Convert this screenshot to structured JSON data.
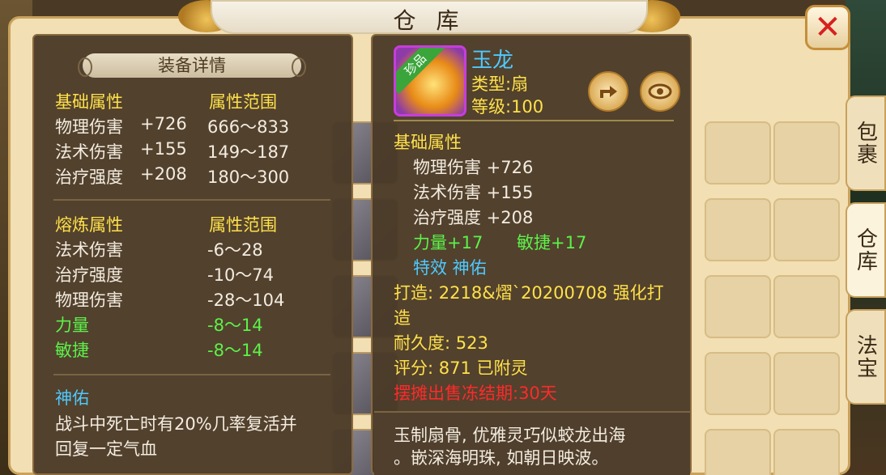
{
  "window": {
    "title": "仓 库",
    "close": "✕"
  },
  "side_tabs": [
    "包裹",
    "仓库",
    "法宝"
  ],
  "detail": {
    "header": "装备详情",
    "base": {
      "title": "基础属性",
      "range_title": "属性范围",
      "rows": [
        {
          "name": "物理伤害",
          "value": "+726",
          "range": "666～833"
        },
        {
          "name": "法术伤害",
          "value": "+155",
          "range": "149～187"
        },
        {
          "name": "治疗强度",
          "value": "+208",
          "range": "180～300"
        }
      ]
    },
    "refine": {
      "title": "熔炼属性",
      "range_title": "属性范围",
      "rows": [
        {
          "name": "法术伤害",
          "range": "-6～28"
        },
        {
          "name": "治疗强度",
          "range": "-10～74"
        },
        {
          "name": "物理伤害",
          "range": "-28～104"
        },
        {
          "name": "力量",
          "range": "-8～14"
        },
        {
          "name": "敏捷",
          "range": "-8～14"
        }
      ]
    },
    "effect": {
      "title": "神佑",
      "desc_line1": "战斗中死亡时有20%几率复活并",
      "desc_line2": "回复一定气血"
    }
  },
  "item": {
    "badge": "珍品",
    "name": "玉龙",
    "type": "类型:扇",
    "level": "等级:100",
    "base_title": "基础属性",
    "stats": [
      "物理伤害 +726",
      "法术伤害 +155",
      "治疗强度 +208"
    ],
    "bonus_str": "力量+17",
    "bonus_agi": "敏捷+17",
    "special": "特效  神佑",
    "crafted_line1": "打造: 2218&熠`20200708   强化打",
    "crafted_line2": "造",
    "durability": "耐久度: 523",
    "score": "评分: 871   已附灵",
    "frozen": "摆摊出售冻结期:30天",
    "lore_line1": "玉制扇骨, 优雅灵巧似蛟龙出海",
    "lore_line2": "。嵌深海明珠, 如朝日映波。"
  },
  "icons": {
    "share": "share-icon",
    "eye": "eye-icon"
  }
}
